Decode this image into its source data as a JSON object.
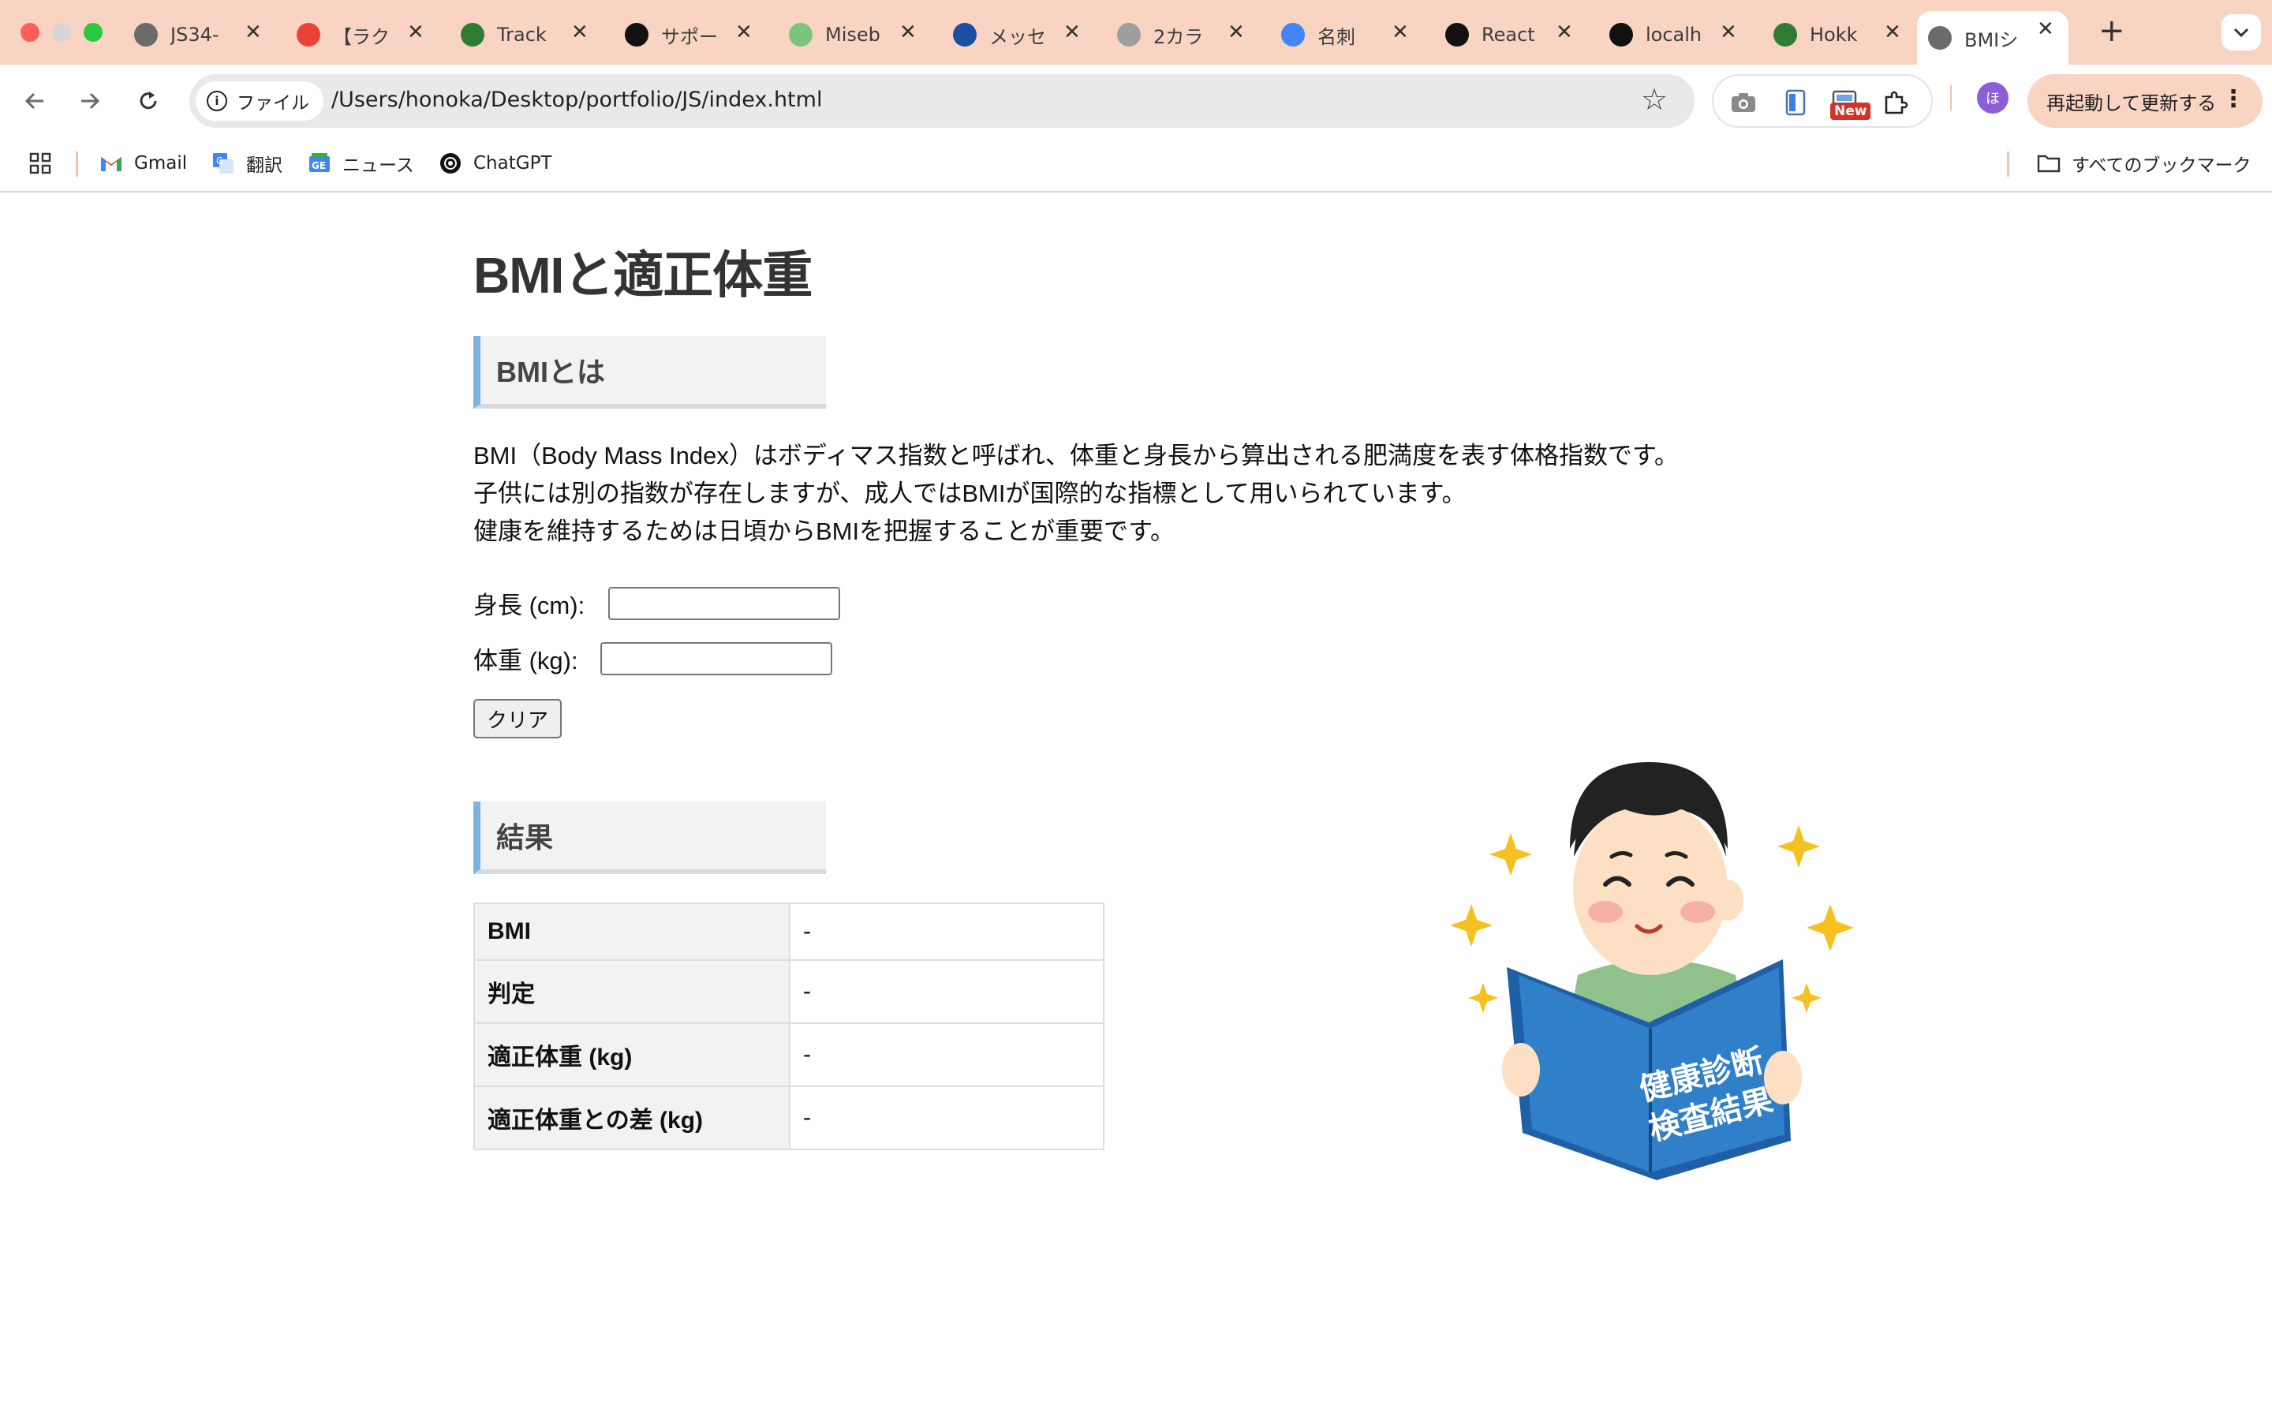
{
  "browser": {
    "tabs": [
      {
        "title": "JS34-",
        "favicon": "globe-icon",
        "color": "#6b6b6b"
      },
      {
        "title": "【ラク",
        "favicon": "gmail-icon",
        "color": "#ea4335"
      },
      {
        "title": "Track",
        "favicon": "track-icon",
        "color": "#2e7d32"
      },
      {
        "title": "サポー",
        "favicon": "support-icon",
        "color": "#111111"
      },
      {
        "title": "Miseb",
        "favicon": "cart-icon",
        "color": "#7cc47c"
      },
      {
        "title": "メッセ",
        "favicon": "message-icon",
        "color": "#1a4fa3"
      },
      {
        "title": "2カラ",
        "favicon": "s-circle-icon",
        "color": "#9e9e9e"
      },
      {
        "title": "名刺",
        "favicon": "google-icon",
        "color": "#4285f4"
      },
      {
        "title": "React",
        "favicon": "openai-icon",
        "color": "#111111"
      },
      {
        "title": "localh",
        "favicon": "triangle-icon",
        "color": "#111111"
      },
      {
        "title": "Hokk",
        "favicon": "hokkaido-icon",
        "color": "#2e7d32"
      },
      {
        "title": "BMIシ",
        "favicon": "globe-icon",
        "color": "#6b6b6b",
        "active": true
      }
    ],
    "new_tab": "+",
    "address": {
      "scheme_label": "ファイル",
      "url": "/Users/honoka/Desktop/portfolio/JS/index.html"
    },
    "new_badge": "New",
    "avatar_letter": "ほ",
    "relaunch_label": "再起動して更新する",
    "bookmarks": [
      {
        "label": "Gmail",
        "icon": "gmail-icon"
      },
      {
        "label": "翻訳",
        "icon": "translate-icon"
      },
      {
        "label": "ニュース",
        "icon": "news-icon"
      },
      {
        "label": "ChatGPT",
        "icon": "openai-icon"
      }
    ],
    "all_bookmarks": "すべてのブックマーク"
  },
  "page": {
    "title": "BMIと適正体重",
    "about": {
      "heading": "BMIとは",
      "lines": [
        "BMI（Body Mass Index）はボディマス指数と呼ばれ、体重と身長から算出される肥満度を表す体格指数です。",
        "子供には別の指数が存在しますが、成人ではBMIが国際的な指標として用いられています。",
        "健康を維持するためは日頃からBMIを把握することが重要です。"
      ]
    },
    "form": {
      "height_label": "身長 (cm):",
      "height_value": "",
      "weight_label": "体重 (kg):",
      "weight_value": "",
      "clear_label": "クリア"
    },
    "result": {
      "heading": "結果",
      "rows": [
        {
          "key": "BMI",
          "value": "-"
        },
        {
          "key": "判定",
          "value": "-"
        },
        {
          "key": "適正体重 (kg)",
          "value": "-"
        },
        {
          "key": "適正体重との差 (kg)",
          "value": "-"
        }
      ]
    },
    "illustration": {
      "book_line1": "健康診断",
      "book_line2": "検査結果"
    }
  },
  "colors": {
    "tabstrip": "#f9d4c3",
    "heading_accent": "#7fb2e0",
    "book_blue": "#2f7fc9",
    "sparkle": "#f5c020"
  }
}
